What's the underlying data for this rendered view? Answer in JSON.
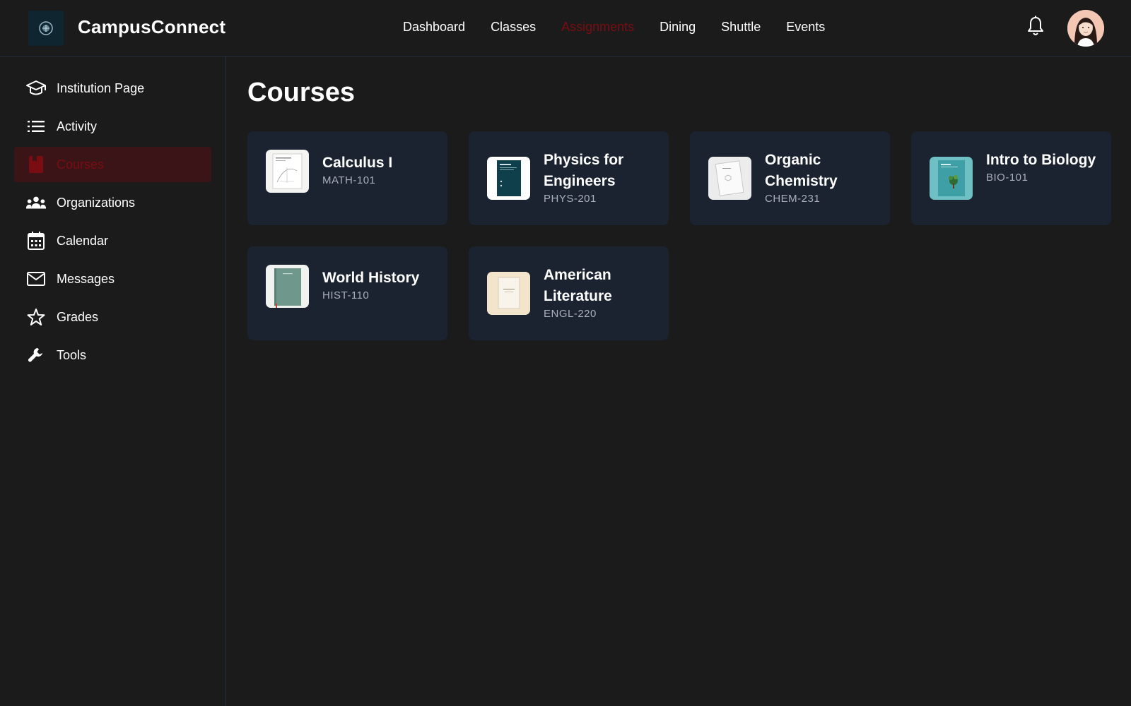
{
  "app": {
    "title": "CampusConnect",
    "logo_icon": "globe-seal-icon"
  },
  "topnav": {
    "items": [
      "Dashboard",
      "Classes",
      "Assignments",
      "Dining",
      "Shuttle",
      "Events"
    ],
    "active": "Assignments",
    "active_color": "#7a0d12"
  },
  "header_icons": {
    "notifications": "bell-icon",
    "profile": "user-avatar"
  },
  "sidebar": {
    "items": [
      {
        "label": "Institution Page",
        "icon": "graduation-cap-icon"
      },
      {
        "label": "Activity",
        "icon": "list-icon"
      },
      {
        "label": "Courses",
        "icon": "book-icon",
        "active": true
      },
      {
        "label": "Organizations",
        "icon": "people-group-icon"
      },
      {
        "label": "Calendar",
        "icon": "calendar-icon"
      },
      {
        "label": "Messages",
        "icon": "envelope-icon"
      },
      {
        "label": "Grades",
        "icon": "star-icon"
      },
      {
        "label": "Tools",
        "icon": "wrench-icon"
      }
    ]
  },
  "main": {
    "title": "Courses",
    "courses": [
      {
        "title": "Calculus I",
        "code": "MATH-101"
      },
      {
        "title": "Physics for Engineers",
        "code": "PHYS-201"
      },
      {
        "title": "Organic Chemistry",
        "code": "CHEM-231"
      },
      {
        "title": "Intro to Biology",
        "code": "BIO-101"
      },
      {
        "title": "World History",
        "code": "HIST-110"
      },
      {
        "title": "American Literature",
        "code": "ENGL-220"
      }
    ]
  },
  "colors": {
    "background": "#1b1b1b",
    "card": "#1b2230",
    "accent": "#7a0d12",
    "active_bg": "#3a1417",
    "muted_text": "#a9b0bc"
  }
}
